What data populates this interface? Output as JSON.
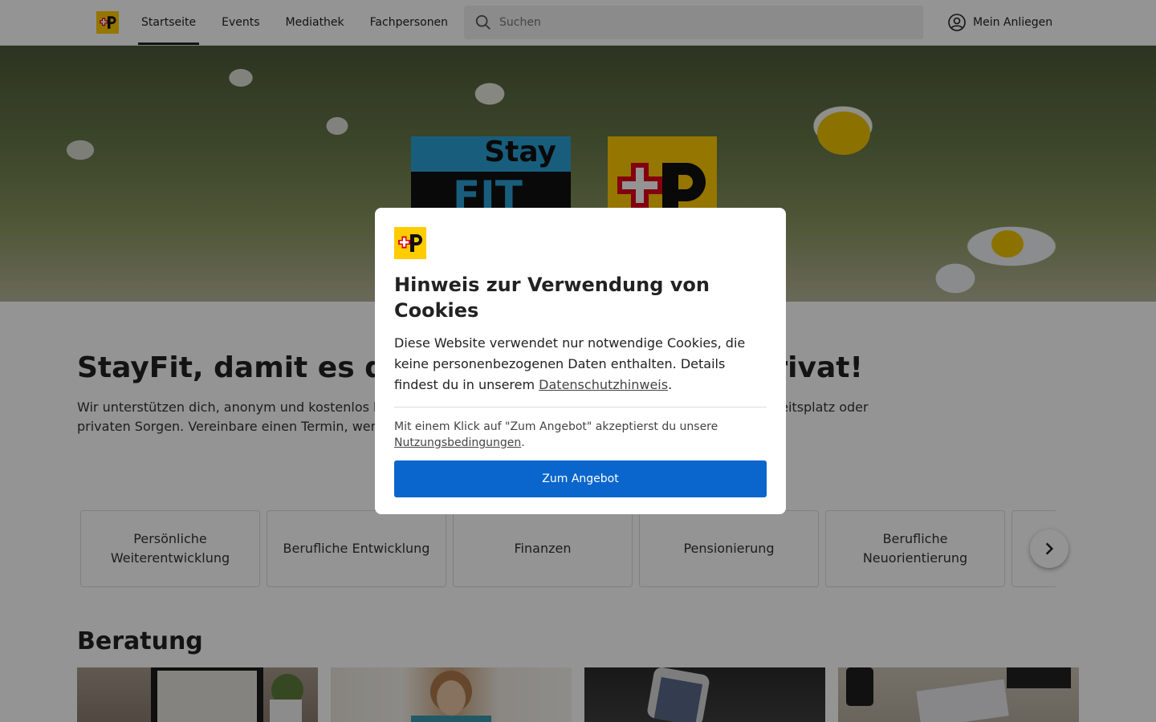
{
  "header": {
    "nav": [
      {
        "label": "Startseite",
        "active": true
      },
      {
        "label": "Events",
        "active": false
      },
      {
        "label": "Mediathek",
        "active": false
      },
      {
        "label": "Fachpersonen",
        "active": false
      }
    ],
    "search": {
      "placeholder": "Suchen",
      "value": ""
    },
    "account_label": "Mein Anliegen"
  },
  "hero": {
    "stayfit_top": "Stay",
    "stayfit_bottom": "FIT"
  },
  "main": {
    "headline": "StayFit, damit es dir gut geht im Job und privat!",
    "intro": "Wir unterstützen dich, anonym und kostenlos bei Fragen rund um deine Gesundheit, bei Spannungen am Arbeitsplatz oder privaten Sorgen. Vereinbare einen Termin, wende dich per Chat an uns oder besuche spannende Events.",
    "categories": [
      "Persönliche Weiterentwicklung",
      "Berufliche Entwicklung",
      "Finanzen",
      "Pensionierung",
      "Berufliche Neuorientierung"
    ],
    "section_title": "Beratung"
  },
  "modal": {
    "title": "Hinweis zur Verwendung von Cookies",
    "text_before_link": "Diese Website verwendet nur notwendige Cookies, die keine personenbezogenen Daten enthalten. Details findest du in unserem ",
    "privacy_link": "Datenschutzhinweis",
    "text_after_link": ".",
    "terms_text": "Mit einem Klick auf \"Zum Angebot\" akzeptierst du unsere ",
    "terms_link": "Nutzungsbedingungen",
    "terms_after": ".",
    "button_label": "Zum Angebot"
  },
  "colors": {
    "brand_yellow": "#ffcc00",
    "brand_red": "#e2001a",
    "primary_button": "#0a66cc",
    "stayfit_blue": "#2aa3d6"
  }
}
